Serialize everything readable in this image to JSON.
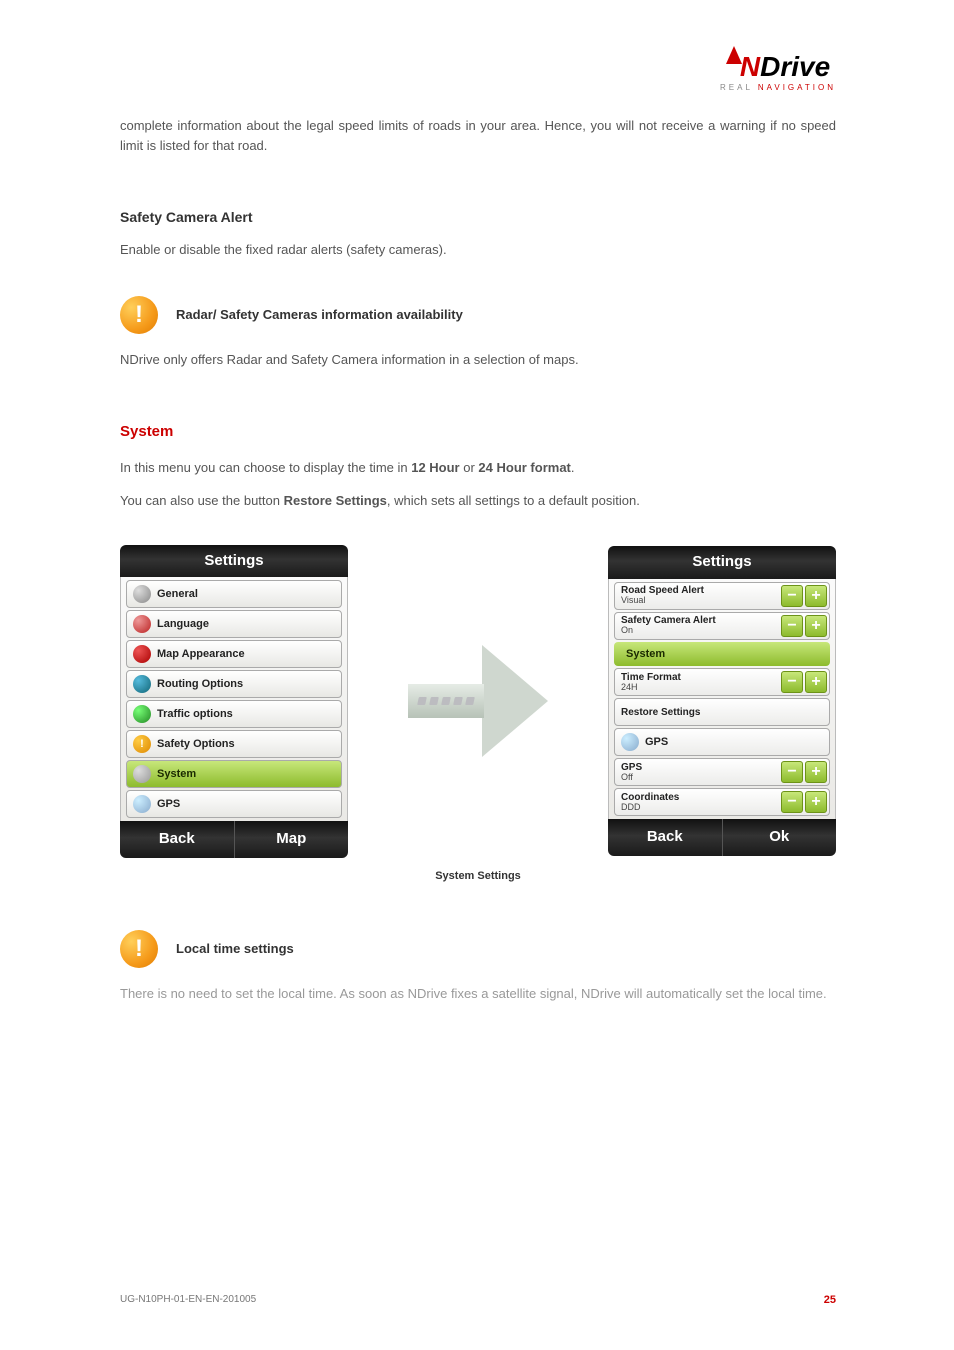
{
  "logo": {
    "brand_n": "N",
    "brand_rest": "Drive",
    "sub_pre": "REAL ",
    "sub_nav": "NAVIGATION"
  },
  "intro": "complete information about the legal speed limits of roads in your area. Hence, you will not receive a warning if no speed limit is listed for that road.",
  "section_safety": {
    "title": "Safety Camera Alert",
    "text": "Enable or disable the fixed radar alerts (safety cameras)."
  },
  "callout_radar": {
    "title": "Radar/ Safety Cameras information availability",
    "text": "NDrive only offers Radar and Safety Camera information in a selection of maps."
  },
  "section_system": {
    "title": "System",
    "line1a": "In this menu you can choose to display the time in ",
    "line1b": "12 Hour",
    "line1c": " or ",
    "line1d": "24 Hour format",
    "line1e": ".",
    "line2a": "You can also use the button ",
    "line2b": "Restore Settings",
    "line2c": ", which sets all settings to a default position."
  },
  "left_screen": {
    "title": "Settings",
    "items": [
      {
        "label": "General"
      },
      {
        "label": "Language"
      },
      {
        "label": "Map Appearance"
      },
      {
        "label": "Routing Options"
      },
      {
        "label": "Traffic options"
      },
      {
        "label": "Safety Options"
      },
      {
        "label": "System"
      },
      {
        "label": "GPS"
      }
    ],
    "back": "Back",
    "map": "Map"
  },
  "right_screen": {
    "title": "Settings",
    "road_speed": {
      "label": "Road Speed Alert",
      "value": "Visual"
    },
    "safety_cam": {
      "label": "Safety Camera Alert",
      "value": "On"
    },
    "group_system": "System",
    "time_format": {
      "label": "Time Format",
      "value": "24H"
    },
    "restore": "Restore Settings",
    "group_gps": "GPS",
    "gps": {
      "label": "GPS",
      "value": "Off"
    },
    "coords": {
      "label": "Coordinates",
      "value": "DDD"
    },
    "back": "Back",
    "ok": "Ok"
  },
  "caption": "System Settings",
  "callout_time": {
    "title": "Local time settings",
    "text": "There is no need to set the local time. As soon as NDrive fixes a satellite signal, NDrive will automatically set the local time."
  },
  "footer": {
    "doc": "UG-N10PH-01-EN-EN-201005",
    "page": "25"
  }
}
